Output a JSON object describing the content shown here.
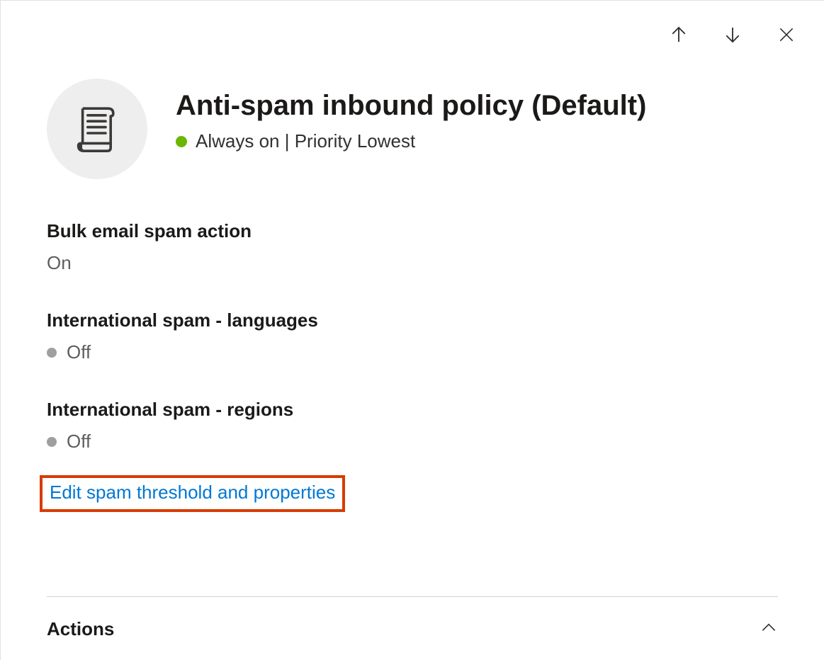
{
  "header": {
    "title": "Anti-spam inbound policy (Default)",
    "status_text": "Always on | Priority Lowest"
  },
  "settings": [
    {
      "label": "Bulk email spam action",
      "value": "On",
      "show_dot": false
    },
    {
      "label": "International spam - languages",
      "value": "Off",
      "show_dot": true
    },
    {
      "label": "International spam - regions",
      "value": "Off",
      "show_dot": true
    }
  ],
  "edit_link": "Edit spam threshold and properties",
  "actions_section": {
    "label": "Actions"
  }
}
